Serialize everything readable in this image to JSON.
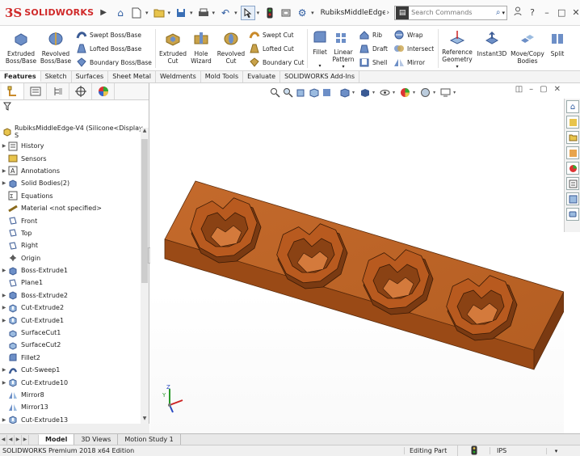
{
  "app": {
    "brand": "SOLIDWORKS",
    "logo_mark": "3S",
    "document_title": "RubiksMiddleEdge..."
  },
  "search": {
    "placeholder": "Search Commands"
  },
  "ribbon": {
    "features": {
      "extruded_boss": "Extruded\nBoss/Base",
      "revolved_boss": "Revolved\nBoss/Base",
      "swept_boss": "Swept Boss/Base",
      "lofted_boss": "Lofted Boss/Base",
      "boundary_boss": "Boundary Boss/Base",
      "extruded_cut": "Extruded\nCut",
      "hole_wizard": "Hole\nWizard",
      "revolved_cut": "Revolved\nCut",
      "swept_cut": "Swept Cut",
      "lofted_cut": "Lofted Cut",
      "boundary_cut": "Boundary Cut",
      "fillet": "Fillet",
      "linear_pattern": "Linear\nPattern",
      "rib": "Rib",
      "draft": "Draft",
      "shell": "Shell",
      "wrap": "Wrap",
      "intersect": "Intersect",
      "mirror": "Mirror",
      "reference_geometry": "Reference\nGeometry",
      "instant3d": "Instant3D",
      "move_copy": "Move/Copy\nBodies",
      "split": "Split"
    }
  },
  "command_tabs": [
    "Features",
    "Sketch",
    "Surfaces",
    "Sheet Metal",
    "Weldments",
    "Mold Tools",
    "Evaluate",
    "SOLIDWORKS Add-Ins"
  ],
  "tree": {
    "root": "RubiksMiddleEdge-V4  (Silicone<Display S",
    "items": [
      {
        "label": "History",
        "exp": true,
        "icon": "history-icon"
      },
      {
        "label": "Sensors",
        "exp": false,
        "icon": "sensors-icon"
      },
      {
        "label": "Annotations",
        "exp": true,
        "icon": "annotations-icon"
      },
      {
        "label": "Solid Bodies(2)",
        "exp": true,
        "icon": "solid-bodies-icon"
      },
      {
        "label": "Equations",
        "exp": false,
        "icon": "equations-icon"
      },
      {
        "label": "Material <not specified>",
        "exp": false,
        "icon": "material-icon"
      },
      {
        "label": "Front",
        "exp": false,
        "icon": "plane-icon"
      },
      {
        "label": "Top",
        "exp": false,
        "icon": "plane-icon"
      },
      {
        "label": "Right",
        "exp": false,
        "icon": "plane-icon"
      },
      {
        "label": "Origin",
        "exp": false,
        "icon": "origin-icon"
      },
      {
        "label": "Boss-Extrude1",
        "exp": true,
        "icon": "extrude-icon"
      },
      {
        "label": "Plane1",
        "exp": false,
        "icon": "plane-icon"
      },
      {
        "label": "Boss-Extrude2",
        "exp": true,
        "icon": "extrude-icon"
      },
      {
        "label": "Cut-Extrude2",
        "exp": true,
        "icon": "cut-icon"
      },
      {
        "label": "Cut-Extrude1",
        "exp": true,
        "icon": "cut-icon"
      },
      {
        "label": "SurfaceCut1",
        "exp": false,
        "icon": "surface-cut-icon"
      },
      {
        "label": "SurfaceCut2",
        "exp": false,
        "icon": "surface-cut-icon"
      },
      {
        "label": "Fillet2",
        "exp": false,
        "icon": "fillet-icon"
      },
      {
        "label": "Cut-Sweep1",
        "exp": true,
        "icon": "sweep-icon"
      },
      {
        "label": "Cut-Extrude10",
        "exp": true,
        "icon": "cut-icon"
      },
      {
        "label": "Mirror8",
        "exp": false,
        "icon": "mirror-icon"
      },
      {
        "label": "Mirror13",
        "exp": false,
        "icon": "mirror-icon"
      },
      {
        "label": "Cut-Extrude13",
        "exp": true,
        "icon": "cut-icon"
      }
    ]
  },
  "bottom_tabs": [
    "Model",
    "3D Views",
    "Motion Study 1"
  ],
  "status": {
    "edition": "SOLIDWORKS Premium 2018 x64 Edition",
    "mode": "Editing Part",
    "units": "IPS"
  },
  "triad": {
    "x": "",
    "y": "Y",
    "z": "Z"
  },
  "colors": {
    "part": "#b85a1f",
    "part_dark": "#7a3a12",
    "part_light": "#d47a3c",
    "brand": "#d02a2a"
  }
}
